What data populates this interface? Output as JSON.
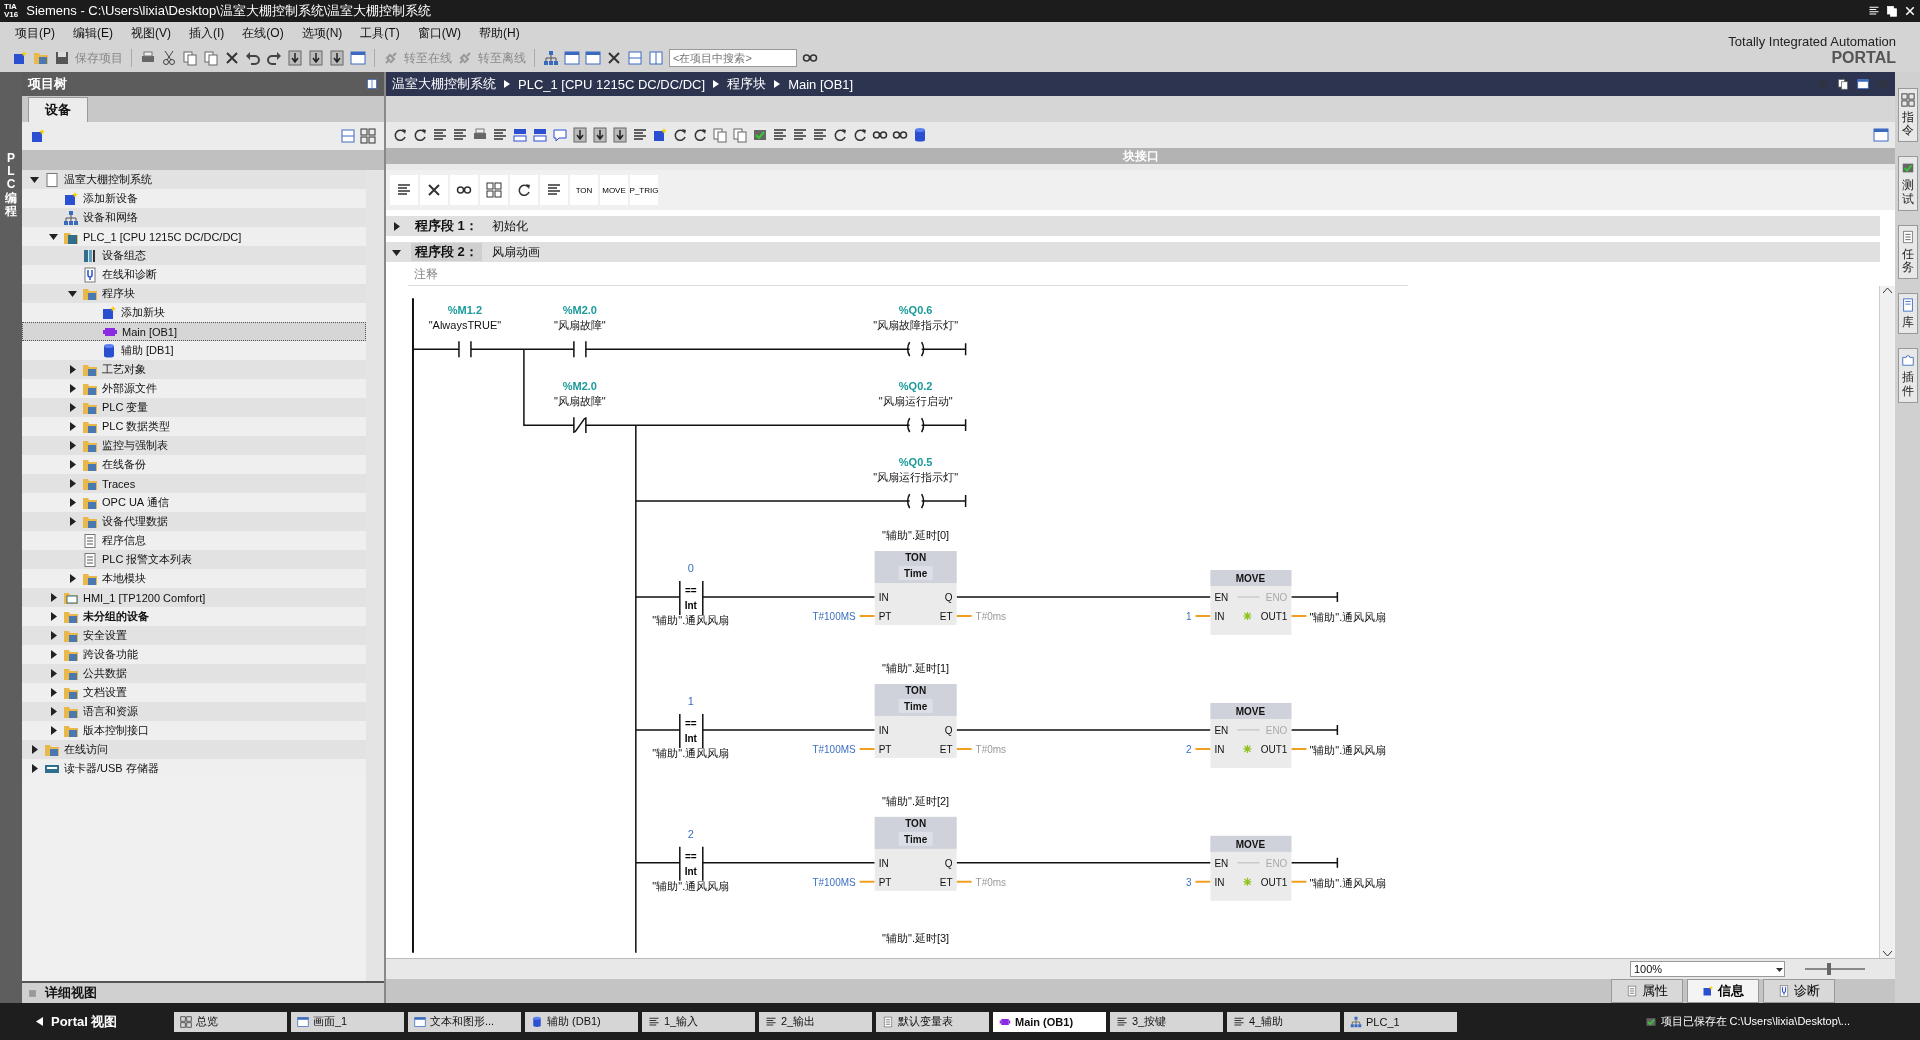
{
  "title_bar": {
    "logo": "TIA\nV16",
    "title": "Siemens  -  C:\\Users\\lixia\\Desktop\\温室大棚控制系统\\温室大棚控制系统"
  },
  "menu": [
    "项目(P)",
    "编辑(E)",
    "视图(V)",
    "插入(I)",
    "在线(O)",
    "选项(N)",
    "工具(T)",
    "窗口(W)",
    "帮助(H)"
  ],
  "toolbar": {
    "save_label": "保存项目",
    "go_online": "转至在线",
    "go_offline": "转至离线",
    "search_placeholder": "<在项目中搜索>"
  },
  "brand": {
    "line1": "Totally Integrated Automation",
    "line2": "PORTAL"
  },
  "side_strip": "PLC 编程",
  "project_tree": {
    "title": "项目树",
    "tab": "设备",
    "items": [
      {
        "label": "温室大棚控制系统",
        "kind": "project",
        "expanded": true,
        "selected": false,
        "children": [
          {
            "label": "添加新设备",
            "kind": "add",
            "selected": false
          },
          {
            "label": "设备和网络",
            "kind": "network",
            "selected": false
          },
          {
            "label": "PLC_1 [CPU 1215C DC/DC/DC]",
            "kind": "plc",
            "expanded": true,
            "selected": false,
            "children": [
              {
                "label": "设备组态",
                "kind": "config",
                "selected": false
              },
              {
                "label": "在线和诊断",
                "kind": "diag",
                "selected": false
              },
              {
                "label": "程序块",
                "kind": "folder",
                "expanded": true,
                "selected": false,
                "children": [
                  {
                    "label": "添加新块",
                    "kind": "add",
                    "selected": false
                  },
                  {
                    "label": "Main [OB1]",
                    "kind": "block",
                    "selected": true
                  },
                  {
                    "label": "辅助 [DB1]",
                    "kind": "db",
                    "selected": false
                  }
                ]
              },
              {
                "label": "工艺对象",
                "kind": "folder",
                "expanded": false,
                "selected": false
              },
              {
                "label": "外部源文件",
                "kind": "folder",
                "expanded": false,
                "selected": false
              },
              {
                "label": "PLC 变量",
                "kind": "folder",
                "expanded": false,
                "selected": false
              },
              {
                "label": "PLC 数据类型",
                "kind": "folder",
                "expanded": false,
                "selected": false
              },
              {
                "label": "监控与强制表",
                "kind": "folder",
                "expanded": false,
                "selected": false
              },
              {
                "label": "在线备份",
                "kind": "folder",
                "expanded": false,
                "selected": false
              },
              {
                "label": "Traces",
                "kind": "folder",
                "expanded": false,
                "selected": false
              },
              {
                "label": "OPC UA 通信",
                "kind": "folder",
                "expanded": false,
                "selected": false
              },
              {
                "label": "设备代理数据",
                "kind": "folder",
                "expanded": false,
                "selected": false
              },
              {
                "label": "程序信息",
                "kind": "info",
                "selected": false
              },
              {
                "label": "PLC 报警文本列表",
                "kind": "list",
                "selected": false
              },
              {
                "label": "本地模块",
                "kind": "folder",
                "expanded": false,
                "selected": false
              }
            ]
          },
          {
            "label": "HMI_1 [TP1200 Comfort]",
            "kind": "hmi",
            "expanded": false,
            "selected": false
          },
          {
            "label": "未分组的设备",
            "kind": "folder",
            "expanded": false,
            "selected": false,
            "bold": true
          },
          {
            "label": "安全设置",
            "kind": "folder",
            "expanded": false,
            "selected": false
          },
          {
            "label": "跨设备功能",
            "kind": "folder",
            "expanded": false,
            "selected": false
          },
          {
            "label": "公共数据",
            "kind": "folder",
            "expanded": false,
            "selected": false
          },
          {
            "label": "文档设置",
            "kind": "folder",
            "expanded": false,
            "selected": false
          },
          {
            "label": "语言和资源",
            "kind": "folder",
            "expanded": false,
            "selected": false
          },
          {
            "label": "版本控制接口",
            "kind": "folder",
            "expanded": false,
            "selected": false
          }
        ]
      },
      {
        "label": "在线访问",
        "kind": "folder",
        "expanded": false,
        "selected": false
      },
      {
        "label": "读卡器/USB 存储器",
        "kind": "card",
        "expanded": false,
        "selected": false
      }
    ]
  },
  "detail_view": "详细视图",
  "editor": {
    "breadcrumb": [
      "温室大棚控制系统",
      "PLC_1 [CPU 1215C DC/DC/DC]",
      "程序块",
      "Main [OB1]"
    ],
    "interface_label": "块接口",
    "palette": [
      "TON",
      "MOVE",
      "P_TRIG"
    ],
    "networks": [
      {
        "label": "程序段 1：",
        "title": "初始化",
        "expanded": false
      },
      {
        "label": "程序段 2：",
        "title": "风扇动画",
        "expanded": true
      }
    ],
    "comment_placeholder": "注释",
    "ladder": {
      "rungs": [
        {
          "elements": [
            {
              "kind": "no",
              "address": "%M1.2",
              "tag": "\"AlwaysTRUE\""
            },
            {
              "kind": "no",
              "address": "%M2.0",
              "tag": "\"风扇故障\""
            }
          ],
          "coil": {
            "address": "%Q0.6",
            "tag": "\"风扇故障指示灯\""
          }
        },
        {
          "elements": [
            {
              "kind": "nc",
              "address": "%M2.0",
              "tag": "\"风扇故障\""
            }
          ],
          "coil": {
            "address": "%Q0.2",
            "tag": "\"风扇运行启动\""
          }
        },
        {
          "coil": {
            "address": "%Q0.5",
            "tag": "\"风扇运行指示灯\""
          }
        }
      ],
      "timer_rows": [
        {
          "compare": {
            "value": "0",
            "op": "==",
            "type": "Int",
            "operand": "\"辅助\".通风风扇"
          },
          "timer": {
            "instance": "\"辅助\".延时[0]",
            "type": "TON",
            "subtype": "Time",
            "in": "IN",
            "q": "Q",
            "pt": "PT",
            "et": "ET",
            "pt_value": "T#100MS",
            "et_value": "T#0ms"
          },
          "move": {
            "title": "MOVE",
            "en": "EN",
            "eno": "ENO",
            "in": "IN",
            "out": "OUT1",
            "in_value": "1",
            "out_value": "\"辅助\".通风风扇"
          }
        },
        {
          "compare": {
            "value": "1",
            "op": "==",
            "type": "Int",
            "operand": "\"辅助\".通风风扇"
          },
          "timer": {
            "instance": "\"辅助\".延时[1]",
            "type": "TON",
            "subtype": "Time",
            "in": "IN",
            "q": "Q",
            "pt": "PT",
            "et": "ET",
            "pt_value": "T#100MS",
            "et_value": "T#0ms"
          },
          "move": {
            "title": "MOVE",
            "en": "EN",
            "eno": "ENO",
            "in": "IN",
            "out": "OUT1",
            "in_value": "2",
            "out_value": "\"辅助\".通风风扇"
          }
        },
        {
          "compare": {
            "value": "2",
            "op": "==",
            "type": "Int",
            "operand": "\"辅助\".通风风扇"
          },
          "timer": {
            "instance": "\"辅助\".延时[2]",
            "type": "TON",
            "subtype": "Time",
            "in": "IN",
            "q": "Q",
            "pt": "PT",
            "et": "ET",
            "pt_value": "T#100MS",
            "et_value": "T#0ms"
          },
          "move": {
            "title": "MOVE",
            "en": "EN",
            "eno": "ENO",
            "in": "IN",
            "out": "OUT1",
            "in_value": "3",
            "out_value": "\"辅助\".通风风扇"
          }
        }
      ],
      "next_instance": "\"辅助\".延时[3]"
    },
    "zoom": "100%",
    "zoom_slider": {
      "level": 0.4
    }
  },
  "right_tabs": [
    "指令",
    "测试",
    "任务",
    "库",
    "插件"
  ],
  "inspector_tabs": [
    {
      "label": "属性",
      "selected": false
    },
    {
      "label": "信息",
      "selected": true
    },
    {
      "label": "诊断",
      "selected": false
    }
  ],
  "taskbar": {
    "portal": "Portal 视图",
    "items": [
      {
        "label": "总览",
        "selected": false
      },
      {
        "label": "画面_1",
        "selected": false
      },
      {
        "label": "文本和图形...",
        "selected": false
      },
      {
        "label": "辅助 (DB1)",
        "selected": false
      },
      {
        "label": "1_输入",
        "selected": false
      },
      {
        "label": "2_输出",
        "selected": false
      },
      {
        "label": "默认变量表",
        "selected": false
      },
      {
        "label": "Main (OB1)",
        "selected": true
      },
      {
        "label": "3_按键",
        "selected": false
      },
      {
        "label": "4_辅助",
        "selected": false
      },
      {
        "label": "PLC_1",
        "selected": false
      }
    ],
    "status": "项目已保存在 C:\\Users\\lixia\\Desktop\\..."
  }
}
